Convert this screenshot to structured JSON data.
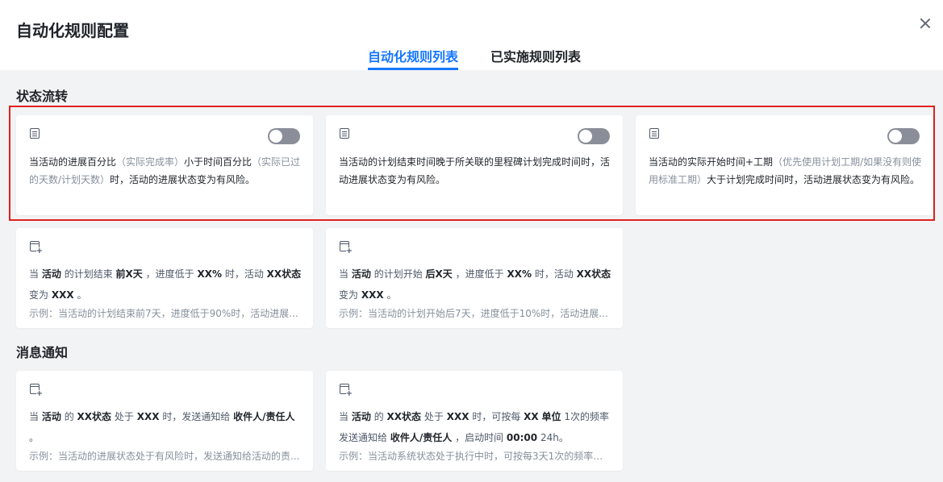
{
  "header": {
    "title": "自动化规则配置",
    "tabs": [
      {
        "label": "自动化规则列表",
        "active": true
      },
      {
        "label": "已实施规则列表",
        "active": false
      }
    ]
  },
  "sections": {
    "status": {
      "title": "状态流转",
      "cards": [
        {
          "icon": "list-icon",
          "toggle_on": false,
          "text1": "当活动的进展百分比",
          "muted1": "（实际完成率）",
          "text2": "小于时间百分比",
          "muted2": "（实际已过的天数/计划天数）",
          "text3": "时，活动的进展状态变为有风险。"
        },
        {
          "icon": "list-icon",
          "toggle_on": false,
          "text": "当活动的计划结束时间晚于所关联的里程碑计划完成时间时，活动进展状态变为有风险。"
        },
        {
          "icon": "list-icon",
          "toggle_on": false,
          "text1": "当活动的实际开始时间+工期",
          "muted1": "（优先使用计划工期/如果没有则使用标准工期）",
          "text2": "大于计划完成时间时，活动进展状态变为有风险。"
        },
        {
          "icon": "calendar-add-icon",
          "p1": "当",
          "b1": "活动",
          "p2": "的计划结束",
          "b2": "前X天",
          "p3": "，进度低于",
          "b3": "XX%",
          "p4": "时，活动",
          "b4": "XX状态",
          "p5": "变为",
          "b5": "XXX",
          "p6": "。",
          "example": "示例：当活动的计划结束前7天，进度低于90%时，活动进展..."
        },
        {
          "icon": "calendar-add-icon",
          "p1": "当",
          "b1": "活动",
          "p2": "的计划开始",
          "b2": "后X天",
          "p3": "，进度低于",
          "b3": "XX%",
          "p4": "时，活动",
          "b4": "XX状态",
          "p5": "变为",
          "b5": "XXX",
          "p6": "。",
          "example": "示例：当活动的计划开始后7天，进度低于10%时，活动进展..."
        }
      ]
    },
    "notify": {
      "title": "消息通知",
      "cards": [
        {
          "icon": "calendar-add-icon",
          "p1": "当",
          "b1": "活动",
          "p2": "的",
          "b2": "XX状态",
          "p3": "处于",
          "b3": "XXX",
          "p4": "时，发送通知给",
          "b4": "收件人/责任人",
          "p5": "。",
          "example": "示例：当活动的进展状态处于有风险时，发送通知给活动的责..."
        },
        {
          "icon": "calendar-add-icon",
          "p1": "当",
          "b1": "活动",
          "p2": "的",
          "b2": "XX状态",
          "p3": "处于",
          "b3": "XXX",
          "p4": "时，可按每",
          "b4": "XX",
          "b5": "单位",
          "p5": "1次的频率发送通知给",
          "b6": "收件人/责任人",
          "p6": "，启动时间",
          "b7": "00:00",
          "p7": "24h。",
          "example": "示例：当活动系统状态处于执行中时，可按每3天1次的频率发..."
        }
      ]
    }
  }
}
